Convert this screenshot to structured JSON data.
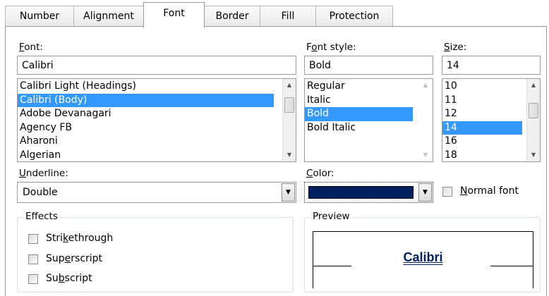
{
  "tabs": [
    {
      "label": "Number"
    },
    {
      "label": "Alignment"
    },
    {
      "label": "Font"
    },
    {
      "label": "Border"
    },
    {
      "label": "Fill"
    },
    {
      "label": "Protection"
    }
  ],
  "font": {
    "label": "Font:",
    "value": "Calibri",
    "items": [
      "Calibri Light (Headings)",
      "Calibri (Body)",
      "Adobe Devanagari",
      "Agency FB",
      "Aharoni",
      "Algerian"
    ],
    "selected": "Calibri (Body)"
  },
  "font_style": {
    "label": "Font style:",
    "value": "Bold",
    "items": [
      "Regular",
      "Italic",
      "Bold",
      "Bold Italic"
    ],
    "selected": "Bold"
  },
  "size": {
    "label": "Size:",
    "value": "14",
    "items": [
      "10",
      "11",
      "12",
      "14",
      "16",
      "18"
    ],
    "selected": "14"
  },
  "underline": {
    "label": "Underline:",
    "value": "Double"
  },
  "color": {
    "label": "Color:",
    "swatch": "#002060"
  },
  "normal_font": {
    "label": "Normal font",
    "checked": false
  },
  "effects": {
    "title": "Effects",
    "strikethrough": {
      "label": "Strikethrough",
      "checked": false
    },
    "superscript": {
      "label": "Superscript",
      "checked": false
    },
    "subscript": {
      "label": "Subscript",
      "checked": false
    }
  },
  "preview": {
    "title": "Preview",
    "sample": "Calibri",
    "sample_color": "#002060"
  },
  "colors": {
    "selection": "#3399ff",
    "border": "#9a9a9a"
  }
}
